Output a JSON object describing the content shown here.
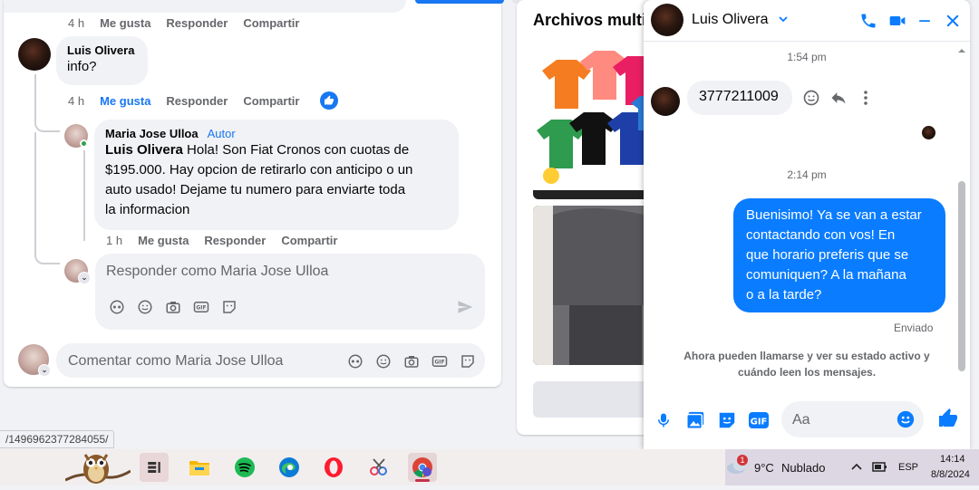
{
  "comments": {
    "top_meta": {
      "time": "4 h",
      "like": "Me gusta",
      "reply": "Responder",
      "share": "Compartir"
    },
    "comment1": {
      "author": "Luis Olivera",
      "text": "info?",
      "meta": {
        "time": "4 h",
        "like": "Me gusta",
        "reply": "Responder",
        "share": "Compartir"
      }
    },
    "reply1": {
      "author": "Maria Jose Ulloa",
      "author_tag": "Autor",
      "mention": "Luis Olivera",
      "text_line1": " Hola! Son Fiat Cronos con cuotas de",
      "text_line2": "$195.000. Hay opcion de retirarlo con anticipo o un",
      "text_line3": "auto usado! Dejame tu numero para enviarte toda",
      "text_line4": "la informacion",
      "meta": {
        "time": "1 h",
        "like": "Me gusta",
        "reply": "Responder",
        "share": "Compartir"
      }
    },
    "reply_input_placeholder": "Responder como Maria Jose Ulloa",
    "comment_input_placeholder": "Comentar como Maria Jose Ulloa"
  },
  "media": {
    "title": "Archivos multimedia"
  },
  "chat": {
    "contact_name": "Luis Olivera",
    "time1": "1:54 pm",
    "incoming_message": "3777211009",
    "time2": "2:14 pm",
    "outgoing_line1": "Buenisimo! Ya se van a estar",
    "outgoing_line2": "contactando con vos! En",
    "outgoing_line3": "que horario preferis que se",
    "outgoing_line4": "comuniquen? A la mañana",
    "outgoing_line5": "o a la tarde?",
    "status": "Enviado",
    "notice_line1": "Ahora pueden llamarse y ver su estado activo y",
    "notice_line2": "cuándo leen los mensajes.",
    "composer_placeholder": "Aa",
    "accent_color": "#0a7cff"
  },
  "status_url": "/1496962377284055/",
  "taskbar": {
    "weather_badge": "1",
    "weather_temp": "9°C",
    "weather_desc": "Nublado",
    "language": "ESP",
    "time": "14:14",
    "date": "8/8/2024"
  }
}
